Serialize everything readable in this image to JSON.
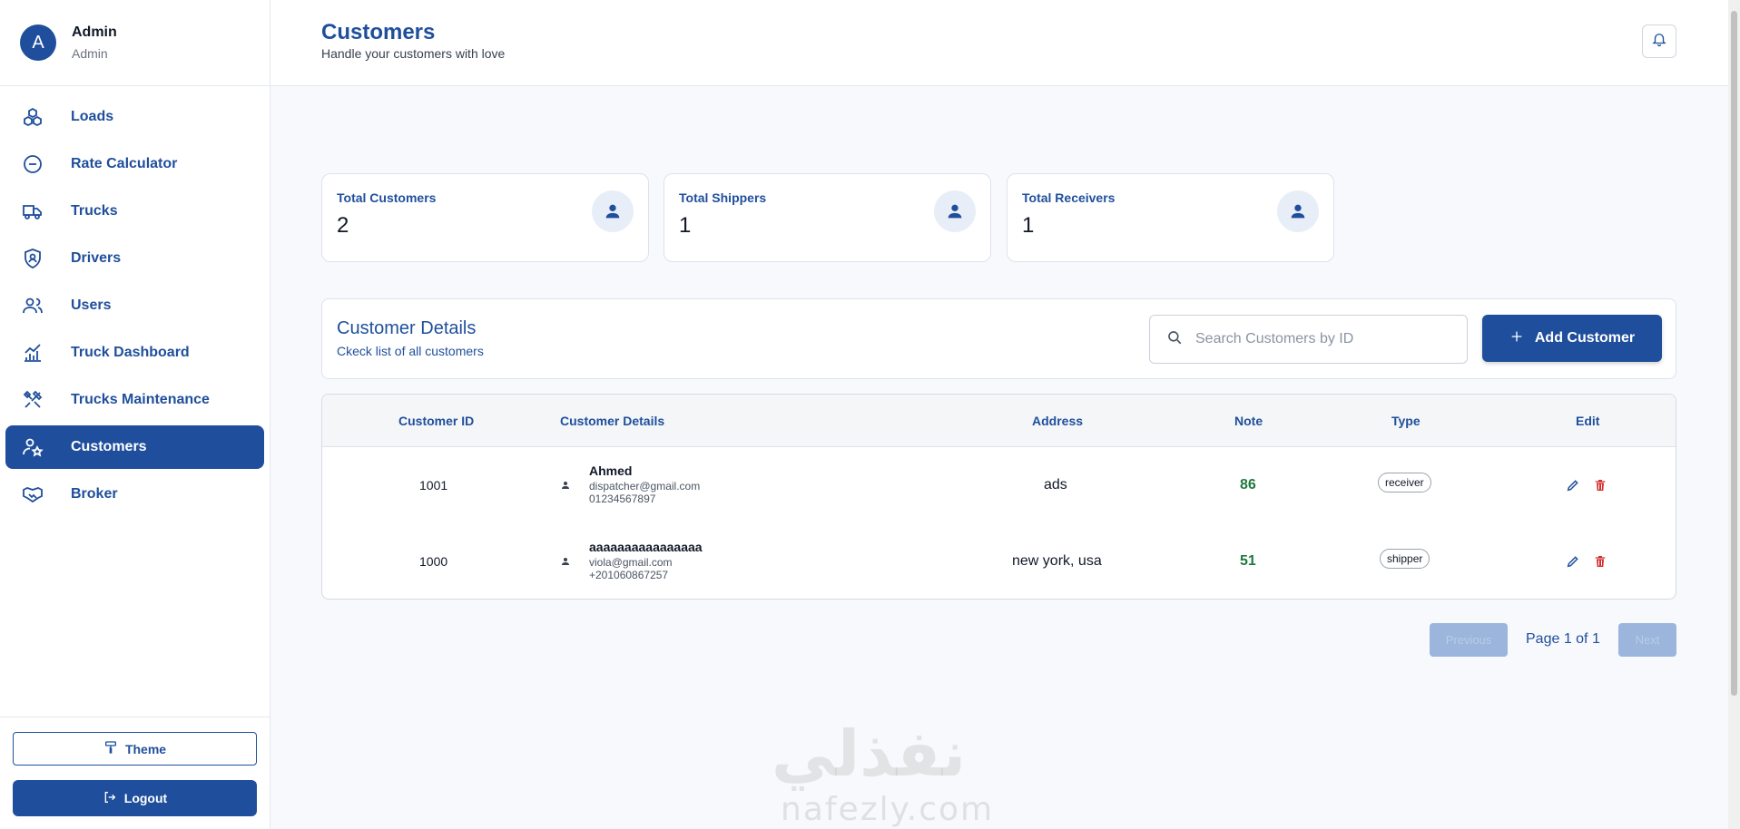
{
  "profile": {
    "initial": "A",
    "name": "Admin",
    "role": "Admin"
  },
  "sidebar": {
    "items": [
      {
        "label": "Loads",
        "icon": "boxes-icon"
      },
      {
        "label": "Rate Calculator",
        "icon": "circle-minus-icon"
      },
      {
        "label": "Trucks",
        "icon": "truck-icon"
      },
      {
        "label": "Drivers",
        "icon": "shield-user-icon"
      },
      {
        "label": "Users",
        "icon": "users-icon"
      },
      {
        "label": "Truck Dashboard",
        "icon": "chart-icon"
      },
      {
        "label": "Trucks Maintenance",
        "icon": "tools-icon"
      },
      {
        "label": "Customers",
        "icon": "user-star-icon",
        "active": true
      },
      {
        "label": "Broker",
        "icon": "handshake-icon"
      }
    ],
    "theme_label": "Theme",
    "logout_label": "Logout"
  },
  "header": {
    "title": "Customers",
    "subtitle": "Handle your customers with love"
  },
  "stats": [
    {
      "label": "Total Customers",
      "value": "2"
    },
    {
      "label": "Total Shippers",
      "value": "1"
    },
    {
      "label": "Total Receivers",
      "value": "1"
    }
  ],
  "details": {
    "title": "Customer Details",
    "subtitle": "Ckeck list of all customers",
    "search_placeholder": "Search Customers by ID",
    "add_label": "Add Customer"
  },
  "table": {
    "columns": [
      "Customer ID",
      "Customer Details",
      "Address",
      "Note",
      "Type",
      "Edit"
    ],
    "rows": [
      {
        "id": "1001",
        "name": "Ahmed",
        "email": "dispatcher@gmail.com",
        "phone": "01234567897",
        "address": "ads",
        "note": "86",
        "type": "receiver"
      },
      {
        "id": "1000",
        "name": "aaaaaaaaaaaaaaaa",
        "email": "viola@gmail.com",
        "phone": "+201060867257",
        "address": "new york, usa",
        "note": "51",
        "type": "shipper"
      }
    ]
  },
  "pagination": {
    "prev_label": "Previous",
    "page_text": "Page 1 of 1",
    "next_label": "Next"
  },
  "watermark": {
    "arabic": "نفذلي",
    "latin": "nafezly.com"
  },
  "colors": {
    "primary": "#1f4f9c",
    "note_green": "#1f7a3e",
    "delete_red": "#d32f2f"
  }
}
